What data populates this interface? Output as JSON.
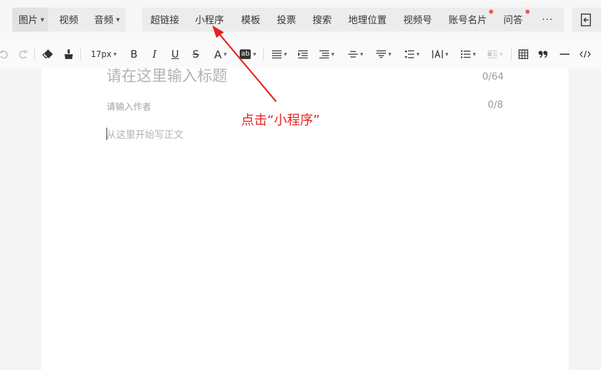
{
  "insert_toolbar": {
    "media": [
      {
        "label": "图片",
        "dropdown": true,
        "active": true
      },
      {
        "label": "视频",
        "dropdown": false
      },
      {
        "label": "音频",
        "dropdown": true
      }
    ],
    "main": [
      {
        "label": "超链接"
      },
      {
        "label": "小程序"
      },
      {
        "label": "模板"
      },
      {
        "label": "投票"
      },
      {
        "label": "搜索"
      },
      {
        "label": "地理位置"
      },
      {
        "label": "视频号"
      },
      {
        "label": "账号名片",
        "dot": true
      },
      {
        "label": "问答",
        "dot": true
      }
    ],
    "more_label": "···"
  },
  "format_toolbar": {
    "font_size": "17px",
    "bold": "B",
    "italic": "I",
    "underline": "U",
    "strike": "S",
    "font_color": "A",
    "highlight": "ab"
  },
  "editor": {
    "title_placeholder": "请在这里输入标题",
    "title_count": "0/64",
    "author_placeholder": "请输入作者",
    "author_count": "0/8",
    "body_placeholder": "从这里开始写正文"
  },
  "annotation": {
    "text": "点击“小程序”",
    "color": "#e8231e"
  },
  "colors": {
    "red_dot": "#fa5151",
    "placeholder": "#b2b2b2"
  }
}
